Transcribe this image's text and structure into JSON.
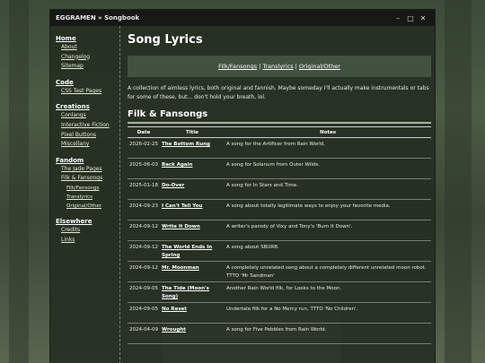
{
  "window": {
    "title": "EGGRAMEN » Songbook"
  },
  "sidebar": {
    "groups": [
      {
        "heading": "Home",
        "items": [
          "About",
          "Changelog",
          "Sitemap"
        ]
      },
      {
        "heading": "Code",
        "items": [
          "CSS Test Pages"
        ]
      },
      {
        "heading": "Creations",
        "items": [
          "Conlangs",
          "Interactive Fiction",
          "Pixel Buttons",
          "Miscellany"
        ]
      },
      {
        "heading": "Fandom",
        "items": [
          "The Jade Pages",
          "Filk & Fansongs"
        ],
        "subitems": [
          "Filk/Fansongs",
          "Translyrics",
          "Original/Other"
        ]
      },
      {
        "heading": "Elsewhere",
        "items": [
          "Credits",
          "Links"
        ]
      }
    ]
  },
  "main": {
    "title": "Song Lyrics",
    "links": [
      "Filk/Fansongs",
      "Translyrics",
      "Original/Other"
    ],
    "links_sep": "|",
    "intro": "A collection of aimless lyrics, both original and fannish. Maybe someday I'll actually make instrumentals or tabs for some of these, but... don't hold your breath, lol.",
    "section_title": "Filk & Fansongs",
    "table": {
      "headers": [
        "Date",
        "Title",
        "Notes"
      ],
      "rows": [
        [
          "2026-02-25",
          "The Bottom Rung",
          "A song for the Artificer from Rain World."
        ],
        [
          "2025-06-03",
          "Back Again",
          "A song for Solanum from Outer Wilds."
        ],
        [
          "2025-01-18",
          "Do-Over",
          "A song for In Stars and Time."
        ],
        [
          "2024-09-23",
          "I Can't Tell You",
          "A song about totally legitimate ways to enjoy your favorite media."
        ],
        [
          "2024-09-12",
          "Write It Down",
          "A writer's parody of Vixy and Tony's 'Burn It Down'."
        ],
        [
          "2024-09-12",
          "The World Ends In Spring",
          "A song about SBURB."
        ],
        [
          "2024-09-12",
          "Mr. Moonman",
          "A completely unrelated song about a completely different unrelated moon robot. TTTO 'Mr Sandman'"
        ],
        [
          "2024-09-05",
          "The Tide (Moon's Song)",
          "Another Rain World filk, for Looks to the Moon."
        ],
        [
          "2024-09-05",
          "No Reset",
          "Undertale filk for a No Mercy run, TTTO 'No Children'."
        ],
        [
          "2024-04-09",
          "Wrought",
          "A song for Five Pebbles from Rain World."
        ]
      ]
    }
  }
}
